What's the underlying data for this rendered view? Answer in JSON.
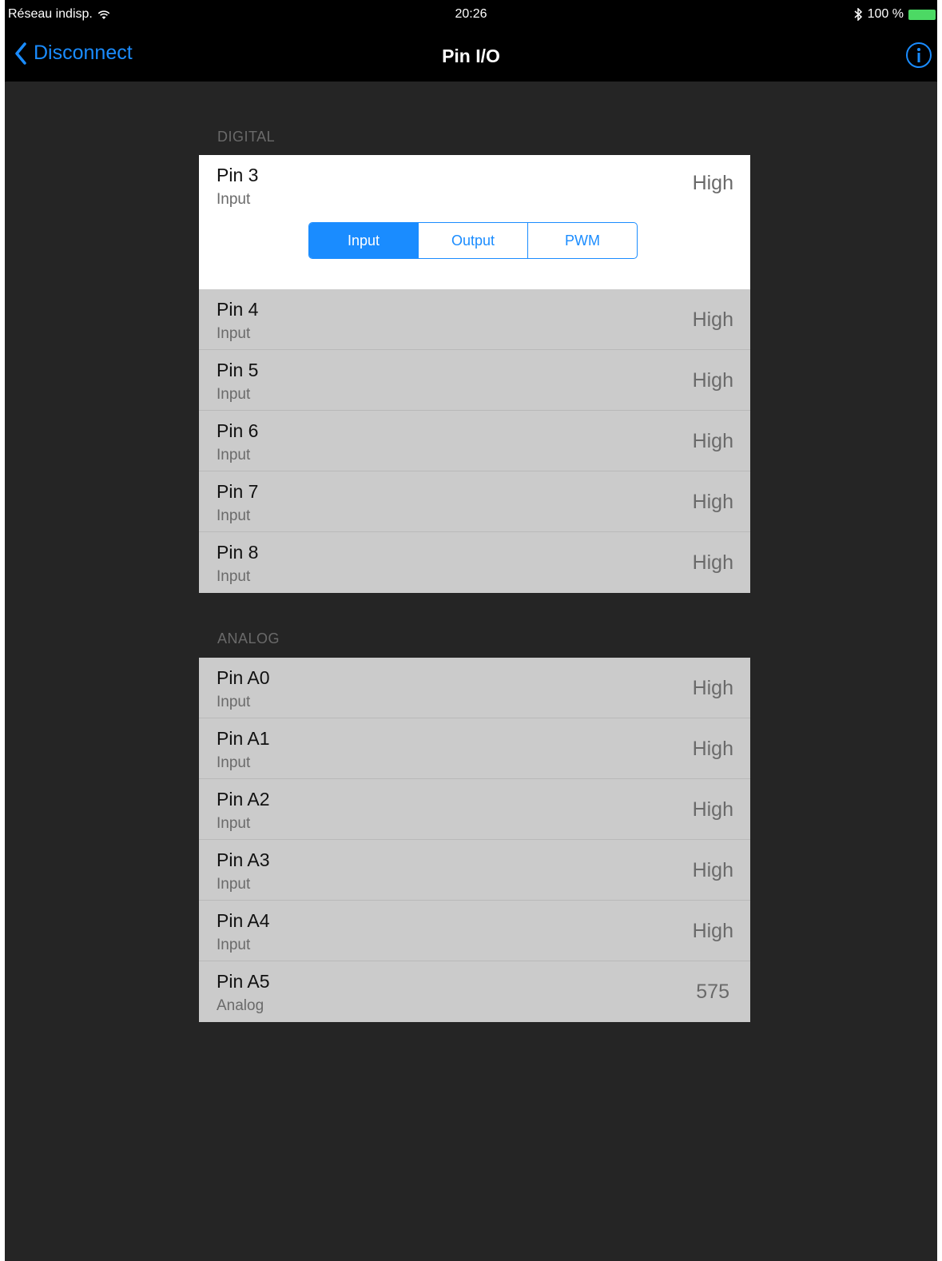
{
  "status_bar": {
    "carrier": "Réseau indisp.",
    "time": "20:26",
    "battery_text": "100 %"
  },
  "nav": {
    "back_label": "Disconnect",
    "title": "Pin I/O",
    "info_icon": "info-icon"
  },
  "accent_color": "#1a8cff",
  "digital": {
    "header": "DIGITAL",
    "selected_pin": {
      "name": "Pin 3",
      "mode": "Input",
      "value": "High",
      "segments": [
        "Input",
        "Output",
        "PWM"
      ],
      "active_segment": "Input"
    },
    "pins": [
      {
        "name": "Pin 4",
        "mode": "Input",
        "value": "High"
      },
      {
        "name": "Pin 5",
        "mode": "Input",
        "value": "High"
      },
      {
        "name": "Pin 6",
        "mode": "Input",
        "value": "High"
      },
      {
        "name": "Pin 7",
        "mode": "Input",
        "value": "High"
      },
      {
        "name": "Pin 8",
        "mode": "Input",
        "value": "High"
      }
    ]
  },
  "analog": {
    "header": "ANALOG",
    "pins": [
      {
        "name": "Pin A0",
        "mode": "Input",
        "value": "High"
      },
      {
        "name": "Pin A1",
        "mode": "Input",
        "value": "High"
      },
      {
        "name": "Pin A2",
        "mode": "Input",
        "value": "High"
      },
      {
        "name": "Pin A3",
        "mode": "Input",
        "value": "High"
      },
      {
        "name": "Pin A4",
        "mode": "Input",
        "value": "High"
      },
      {
        "name": "Pin A5",
        "mode": "Analog",
        "value": "575"
      }
    ]
  }
}
